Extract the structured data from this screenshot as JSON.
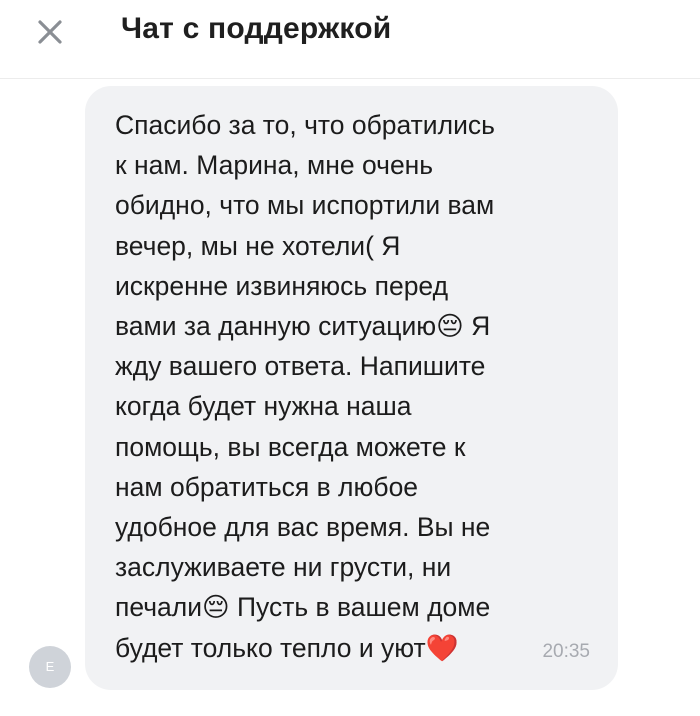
{
  "header": {
    "close_icon": "close-icon",
    "title": "Чат с поддержкой"
  },
  "avatar": {
    "initial": "E"
  },
  "message": {
    "text": "Спасибо за то, что обратились\nк нам. Марина, мне очень\nобидно, что мы испортили вам\nвечер, мы не хотели( Я\nискренне извиняюсь перед\nвами за данную ситуацию😔 Я\nжду вашего ответа. Напишите\nкогда будет нужна наша\nпомощь, вы всегда можете к\nнам обратиться в любое\nудобное для вас время. Вы не\nзаслуживаете ни грусти, ни\nпечали😔 Пусть в вашем доме\nбудет только тепло и уют❤️",
    "time": "20:35"
  },
  "colors": {
    "bubble_bg": "#f1f2f4",
    "text": "#1c1c1c",
    "timestamp": "#a7aab0",
    "avatar_bg": "#cfd3d9"
  }
}
